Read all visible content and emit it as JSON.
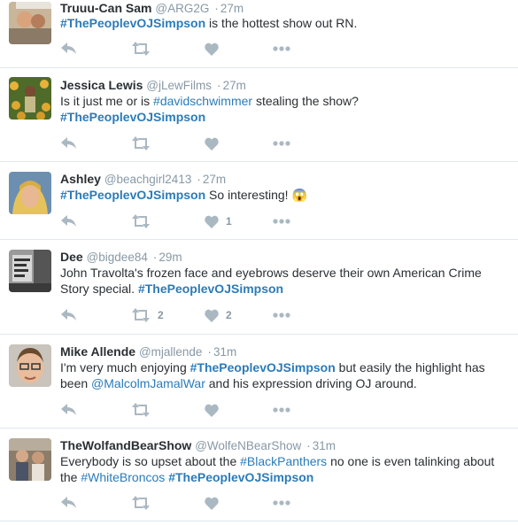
{
  "colors": {
    "link": "#2b7bb9",
    "icon": "#aab8c2",
    "muted": "#8899a6",
    "text": "#292f33",
    "divider": "#e1e8ed"
  },
  "tweets": [
    {
      "name": "Truuu-Can Sam",
      "handle": "@ARG2G",
      "sep": "·",
      "time": "27m",
      "line1": {
        "tag": "#ThePeoplevOJSimpson",
        "rest": " is the hottest show out RN."
      },
      "retweets": "",
      "likes": ""
    },
    {
      "name": "Jessica Lewis",
      "handle": "@jLewFilms",
      "sep": "·",
      "time": "27m",
      "line1": {
        "pre": "Is it just me or is ",
        "tag": "#davidschwimmer",
        "post": " stealing the show?"
      },
      "line2": {
        "tag": "#ThePeoplevOJSimpson"
      },
      "retweets": "",
      "likes": ""
    },
    {
      "name": "Ashley",
      "handle": "@beachgirl2413",
      "sep": "·",
      "time": "27m",
      "line1": {
        "tag": "#ThePeoplevOJSimpson",
        "rest": " So interesting! ",
        "emoji": "😱"
      },
      "retweets": "",
      "likes": "1"
    },
    {
      "name": "Dee",
      "handle": "@bigdee84",
      "sep": "·",
      "time": "29m",
      "line1": {
        "pre": "John Travolta's frozen face and eyebrows deserve their own American Crime"
      },
      "line2": {
        "pre": "Story special. ",
        "tag": "#ThePeoplevOJSimpson"
      },
      "retweets": "2",
      "likes": "2"
    },
    {
      "name": "Mike Allende",
      "handle": "@mjallende",
      "sep": "·",
      "time": "31m",
      "line1": {
        "pre": "I'm very much enjoying ",
        "tag": "#ThePeoplevOJSimpson",
        "post": " but easily the highlight has"
      },
      "line2": {
        "pre": "been ",
        "mention": "@MalcolmJamalWar",
        "post": " and his expression driving OJ around."
      },
      "retweets": "",
      "likes": ""
    },
    {
      "name": "TheWolfandBearShow",
      "handle": "@WolfeNBearShow",
      "sep": "·",
      "time": "31m",
      "line1": {
        "pre": "Everybody is so upset about the ",
        "tag": "#BlackPanthers",
        "post": " no one is even talinking about"
      },
      "line2": {
        "pre": "the ",
        "tag": "#WhiteBroncos",
        "post": " ",
        "tag2": "#ThePeoplevOJSimpson"
      },
      "retweets": "",
      "likes": ""
    }
  ]
}
